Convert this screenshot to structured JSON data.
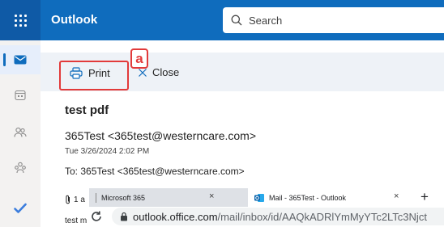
{
  "app": {
    "title": "Outlook"
  },
  "search": {
    "placeholder": "Search"
  },
  "rail": {
    "items": [
      "mail-icon",
      "calendar-icon",
      "people-icon",
      "groups-icon",
      "todo-icon"
    ]
  },
  "toolbar": {
    "print_label": "Print",
    "close_label": "Close"
  },
  "annotation": {
    "label": "a"
  },
  "message": {
    "subject": "test pdf",
    "from": "365Test <365test@westerncare.com>",
    "date": "Tue 3/26/2024 2:02 PM",
    "to": "To:  365Test <365test@westerncare.com>",
    "attachments": "1 a",
    "body": "test m"
  },
  "browser": {
    "tab1_title": "Microsoft 365",
    "tab2_title": "Mail - 365Test - Outlook",
    "tab_close": "×",
    "new_tab": "+",
    "url_host": "outlook.office.com",
    "url_path": "/mail/inbox/id/AAQkADRlYmMyYTc2LTc3Njct"
  },
  "colors": {
    "brand": "#0f6cbd",
    "annotation": "#e23a3a"
  }
}
